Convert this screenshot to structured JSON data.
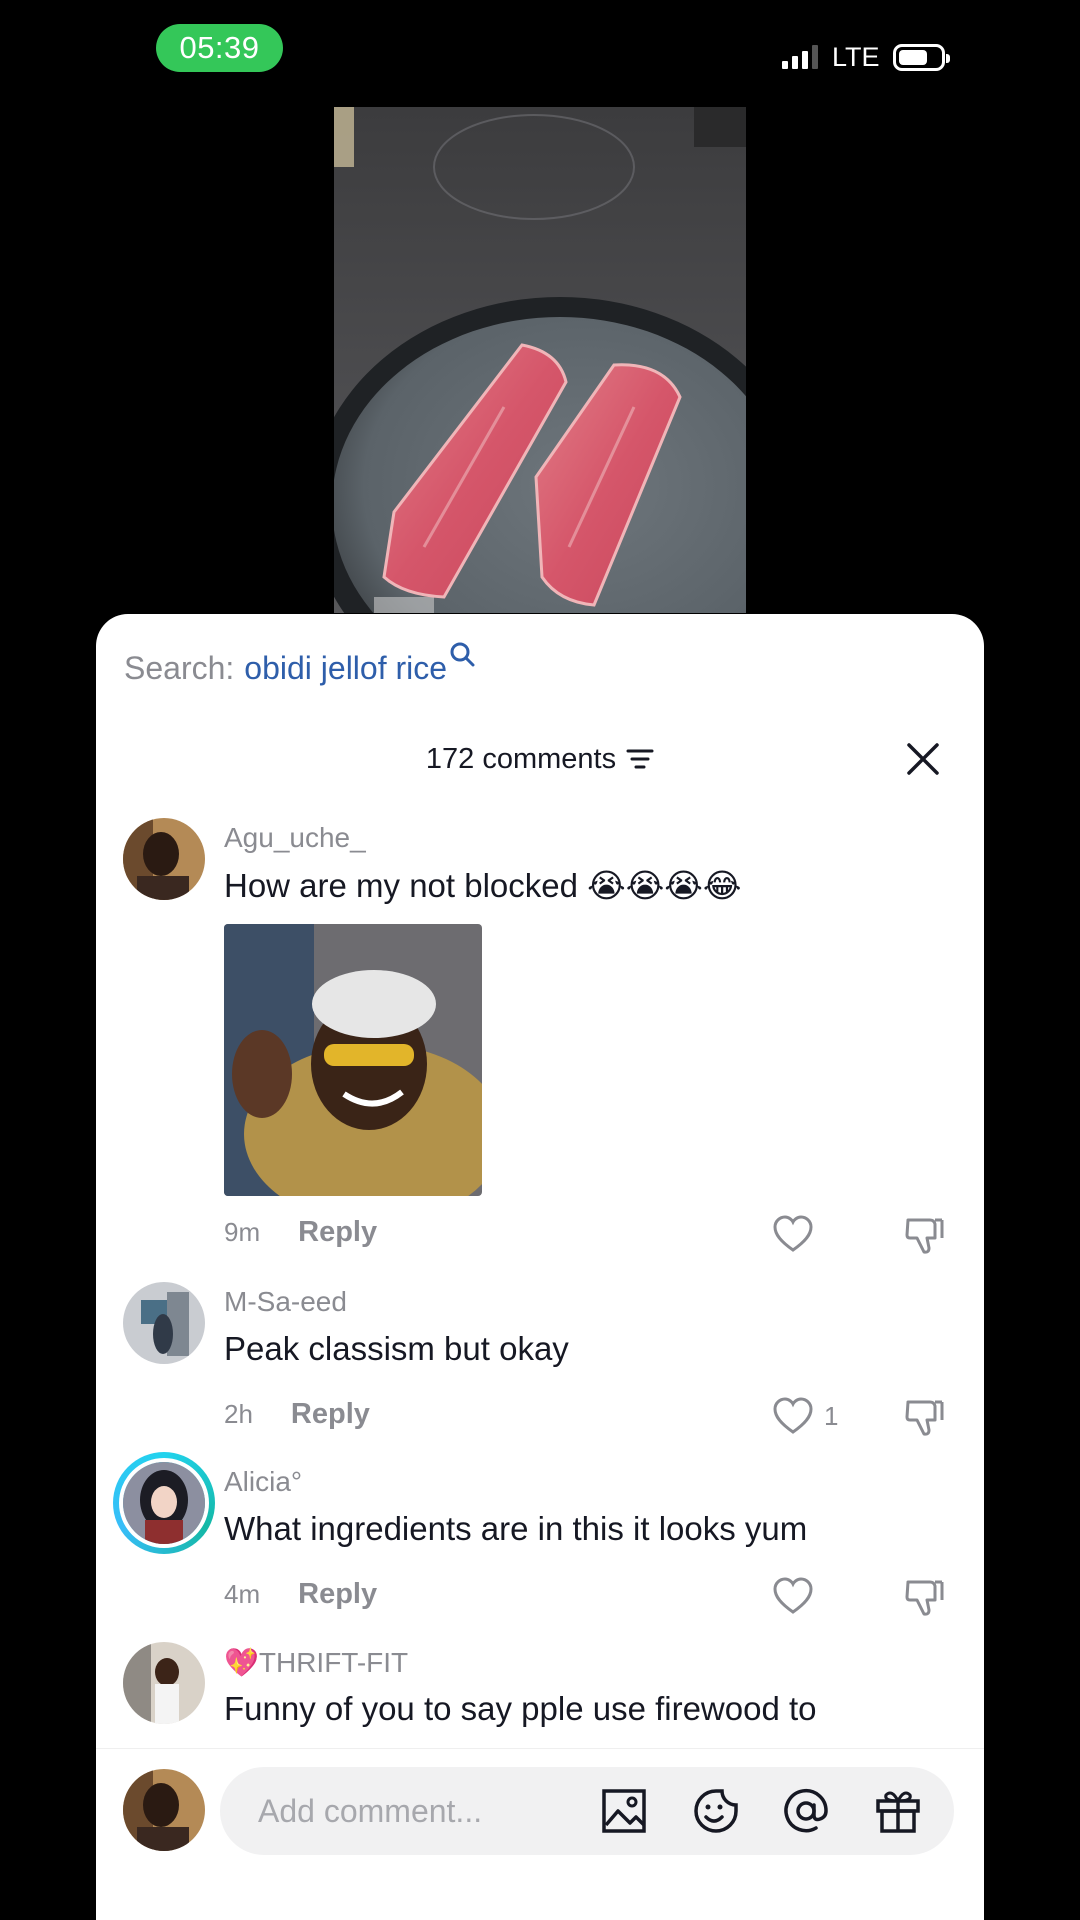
{
  "status_bar": {
    "time": "05:39",
    "network": "LTE",
    "signal_bars_active": 3,
    "signal_bars_total": 4,
    "battery_level": 0.7
  },
  "colors": {
    "accent_time": "#34c759",
    "search_link": "#2e5eaa",
    "muted_text": "#8a8b91",
    "story_ring": "#22d3ee"
  },
  "sheet": {
    "search_prefix": "Search:",
    "search_term": "obidi jellof rice",
    "comments_count": "172 comments",
    "filter_icon": "filter-lines-icon",
    "close_icon": "close-x-icon"
  },
  "comments": [
    {
      "username": "Agu_uche_",
      "text": "How are my not blocked 😭😭😭😂",
      "has_image": true,
      "time": "9m",
      "reply_label": "Reply",
      "likes": ""
    },
    {
      "username": "M-Sa-eed",
      "text": "Peak classism but okay",
      "time": "2h",
      "reply_label": "Reply",
      "likes": "1"
    },
    {
      "username": "Alicia°",
      "text": "What ingredients are in this it looks yum",
      "time": "4m",
      "reply_label": "Reply",
      "likes": "",
      "story_ring": true
    },
    {
      "username": "💖THRIFT-FIT",
      "text": "Funny of you to say pple use firewood to"
    }
  ],
  "composer": {
    "placeholder": "Add comment...",
    "icons": [
      "image-icon",
      "sticker-icon",
      "mention-icon",
      "gift-icon"
    ]
  }
}
